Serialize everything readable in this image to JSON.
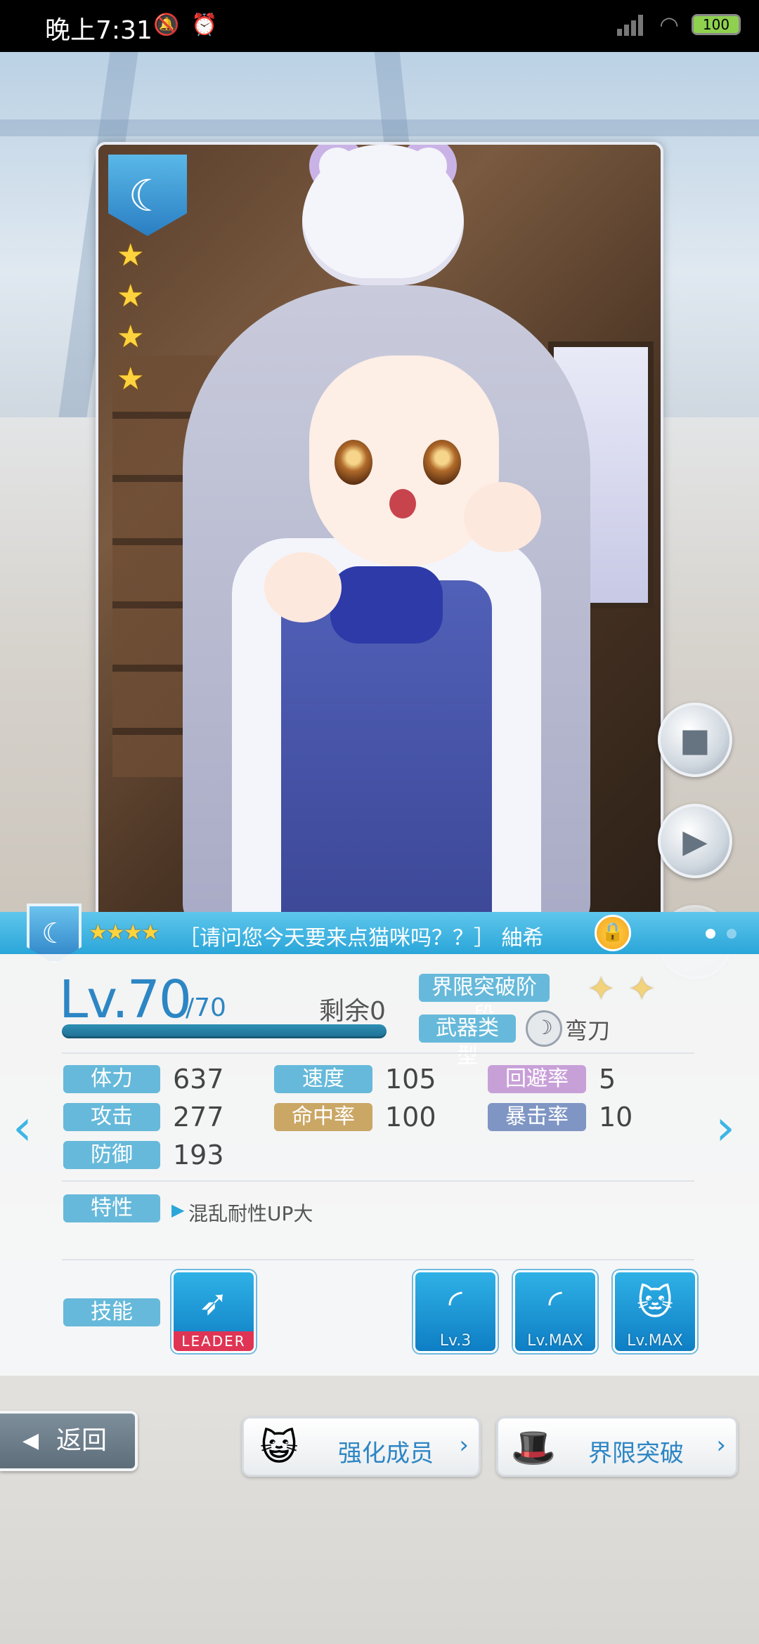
{
  "status_bar": {
    "time": "晚上7:31",
    "icons": [
      "mute-bell-icon",
      "alarm-icon",
      "signal-icon",
      "wifi-icon"
    ],
    "battery": "100"
  },
  "card": {
    "attribute_icon": "moon-icon",
    "rarity_stars": 4
  },
  "banner": {
    "stars": "★★★★",
    "title": "［请问您今天要来点猫咪吗？？］ 紬希"
  },
  "level": {
    "label": "Lv.70",
    "max": "/70",
    "remain": "剩余0",
    "exp_fill": 1.0
  },
  "info": {
    "limit_break_label": "界限突破阶段",
    "limit_break_stars": 2,
    "weapon_label": "武器类型",
    "weapon_value": "弯刀"
  },
  "stats": {
    "hp_label": "体力",
    "hp_value": "637",
    "atk_label": "攻击",
    "atk_value": "277",
    "def_label": "防御",
    "def_value": "193",
    "spd_label": "速度",
    "spd_value": "105",
    "acc_label": "命中率",
    "acc_value": "100",
    "eva_label": "回避率",
    "eva_value": "5",
    "crit_label": "暴击率",
    "crit_value": "10"
  },
  "trait": {
    "label": "特性",
    "value": "混乱耐性UP大"
  },
  "skills": {
    "label": "技能",
    "leader_tag": "LEADER",
    "levels": [
      "Lv.3",
      "Lv.MAX",
      "Lv.MAX"
    ]
  },
  "buttons": {
    "back": "返回",
    "enhance": "强化成员",
    "limit_break": "界限突破"
  },
  "colors": {
    "accent": "#2aa6d9",
    "level_text": "#2d86c4",
    "leader_red": "#e03454",
    "star_gold": "#ffd33d"
  }
}
